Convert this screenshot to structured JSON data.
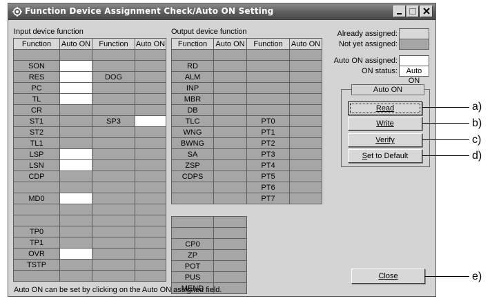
{
  "window": {
    "title": "Function Device Assignment Check/Auto ON Setting"
  },
  "input": {
    "section_label": "Input device function",
    "headers": [
      "Function",
      "Auto ON",
      "Function",
      "Auto ON"
    ],
    "rows": [
      {
        "f1": "",
        "a1": "",
        "f2": "",
        "a2": ""
      },
      {
        "f1": "SON",
        "a1": "w",
        "f2": "",
        "a2": ""
      },
      {
        "f1": "RES",
        "a1": "w",
        "f2": "DOG",
        "a2": ""
      },
      {
        "f1": "PC",
        "a1": "w",
        "f2": "",
        "a2": ""
      },
      {
        "f1": "TL",
        "a1": "w",
        "f2": "",
        "a2": ""
      },
      {
        "f1": "CR",
        "a1": "",
        "f2": "",
        "a2": ""
      },
      {
        "f1": "ST1",
        "a1": "",
        "f2": "SP3",
        "a2": "w"
      },
      {
        "f1": "ST2",
        "a1": "",
        "f2": "",
        "a2": ""
      },
      {
        "f1": "TL1",
        "a1": "",
        "f2": "",
        "a2": ""
      },
      {
        "f1": "LSP",
        "a1": "w",
        "f2": "",
        "a2": ""
      },
      {
        "f1": "LSN",
        "a1": "w",
        "f2": "",
        "a2": ""
      },
      {
        "f1": "CDP",
        "a1": "",
        "f2": "",
        "a2": ""
      },
      {
        "f1": "",
        "a1": "",
        "f2": "",
        "a2": ""
      },
      {
        "f1": "MD0",
        "a1": "w",
        "f2": "",
        "a2": ""
      },
      {
        "f1": "",
        "a1": "",
        "f2": "",
        "a2": ""
      },
      {
        "f1": "",
        "a1": "",
        "f2": "",
        "a2": ""
      },
      {
        "f1": "TP0",
        "a1": "",
        "f2": "",
        "a2": ""
      },
      {
        "f1": "TP1",
        "a1": "",
        "f2": "",
        "a2": ""
      },
      {
        "f1": "OVR",
        "a1": "w",
        "f2": "",
        "a2": ""
      },
      {
        "f1": "TSTP",
        "a1": "",
        "f2": "",
        "a2": ""
      },
      {
        "f1": "",
        "a1": "",
        "f2": "",
        "a2": ""
      }
    ]
  },
  "output": {
    "section_label": "Output device function",
    "headers": [
      "Function",
      "Auto ON",
      "Function",
      "Auto ON"
    ],
    "rows_full": [
      {
        "f1": "",
        "f2": ""
      },
      {
        "f1": "RD",
        "f2": ""
      },
      {
        "f1": "ALM",
        "f2": ""
      },
      {
        "f1": "INP",
        "f2": ""
      },
      {
        "f1": "MBR",
        "f2": ""
      },
      {
        "f1": "DB",
        "f2": ""
      },
      {
        "f1": "TLC",
        "f2": "PT0"
      },
      {
        "f1": "WNG",
        "f2": "PT1"
      },
      {
        "f1": "BWNG",
        "f2": "PT2"
      },
      {
        "f1": "SA",
        "f2": "PT3"
      },
      {
        "f1": "ZSP",
        "f2": "PT4"
      },
      {
        "f1": "CDPS",
        "f2": "PT5"
      },
      {
        "f1": "",
        "f2": "PT6"
      },
      {
        "f1": "",
        "f2": "PT7"
      }
    ],
    "rows_half": [
      "",
      "",
      "CP0",
      "ZP",
      "POT",
      "PUS",
      "MEND"
    ]
  },
  "legend": {
    "already_assigned": "Already assigned:",
    "not_yet_assigned": "Not yet assigned:",
    "auto_on_assigned": "Auto ON assigned:",
    "on_status": "ON status:",
    "on_status_box": "Auto ON"
  },
  "auto_on_group": {
    "title": "Auto ON",
    "read": "Read",
    "write": "Write",
    "verify": "Verify",
    "set_default_prefix": "S",
    "set_default_rest": "et to Default"
  },
  "close_button": "Close",
  "footer_note": "Auto ON can be set by clicking on the Auto ON assigned field.",
  "callouts": [
    "a)",
    "b)",
    "c)",
    "d)",
    "e)"
  ],
  "colors": {
    "assigned": "#d8d8d8",
    "not_assigned": "#a6a6a6",
    "auto_on": "#ffffff"
  }
}
